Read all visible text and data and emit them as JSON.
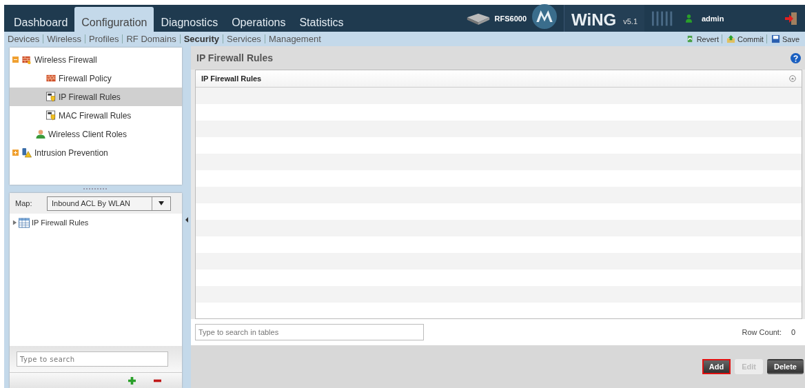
{
  "top_tabs": [
    {
      "label": "Dashboard",
      "selected": false
    },
    {
      "label": "Configuration",
      "selected": true
    },
    {
      "label": "Diagnostics",
      "selected": false
    },
    {
      "label": "Operations",
      "selected": false
    },
    {
      "label": "Statistics",
      "selected": false
    }
  ],
  "header": {
    "device": "RFS6000",
    "product": "WiNG",
    "version": "v5.1",
    "user": "admin"
  },
  "sub_nav": [
    {
      "label": "Devices",
      "selected": false
    },
    {
      "label": "Wireless",
      "selected": false
    },
    {
      "label": "Profiles",
      "selected": false
    },
    {
      "label": "RF Domains",
      "selected": false
    },
    {
      "label": "Security",
      "selected": true
    },
    {
      "label": "Services",
      "selected": false
    },
    {
      "label": "Management",
      "selected": false
    }
  ],
  "actions": [
    {
      "label": "Revert",
      "kind": "revert"
    },
    {
      "label": "Commit",
      "kind": "commit"
    },
    {
      "label": "Save",
      "kind": "save"
    }
  ],
  "tree": [
    {
      "label": "Wireless Firewall",
      "kind": "firewall",
      "selected": false,
      "expanded": true,
      "children": [
        {
          "label": "Firewall Policy",
          "kind": "policy",
          "selected": false
        },
        {
          "label": "IP Firewall Rules",
          "kind": "ip-rules",
          "selected": true
        },
        {
          "label": "MAC Firewall Rules",
          "kind": "mac-rules",
          "selected": false
        }
      ]
    },
    {
      "label": "Wireless Client Roles",
      "kind": "user",
      "selected": false
    },
    {
      "label": "Intrusion Prevention",
      "kind": "intrusion",
      "selected": false,
      "expanded": false
    }
  ],
  "map": {
    "label": "Map:",
    "value": "Inbound ACL By WLAN"
  },
  "map_tree": [
    {
      "label": "IP Firewall Rules",
      "expanded": false
    }
  ],
  "left_search": {
    "placeholder": "Type to search"
  },
  "panel": {
    "title": "IP Firewall Rules",
    "table_title": "IP Firewall Rules",
    "search_placeholder": "Type to search in tables",
    "row_count_label": "Row Count:",
    "row_count": "0"
  },
  "buttons": [
    {
      "label": "Add",
      "disabled": false,
      "focused": true
    },
    {
      "label": "Edit",
      "disabled": true,
      "focused": false
    },
    {
      "label": "Delete",
      "disabled": false,
      "focused": false
    }
  ]
}
